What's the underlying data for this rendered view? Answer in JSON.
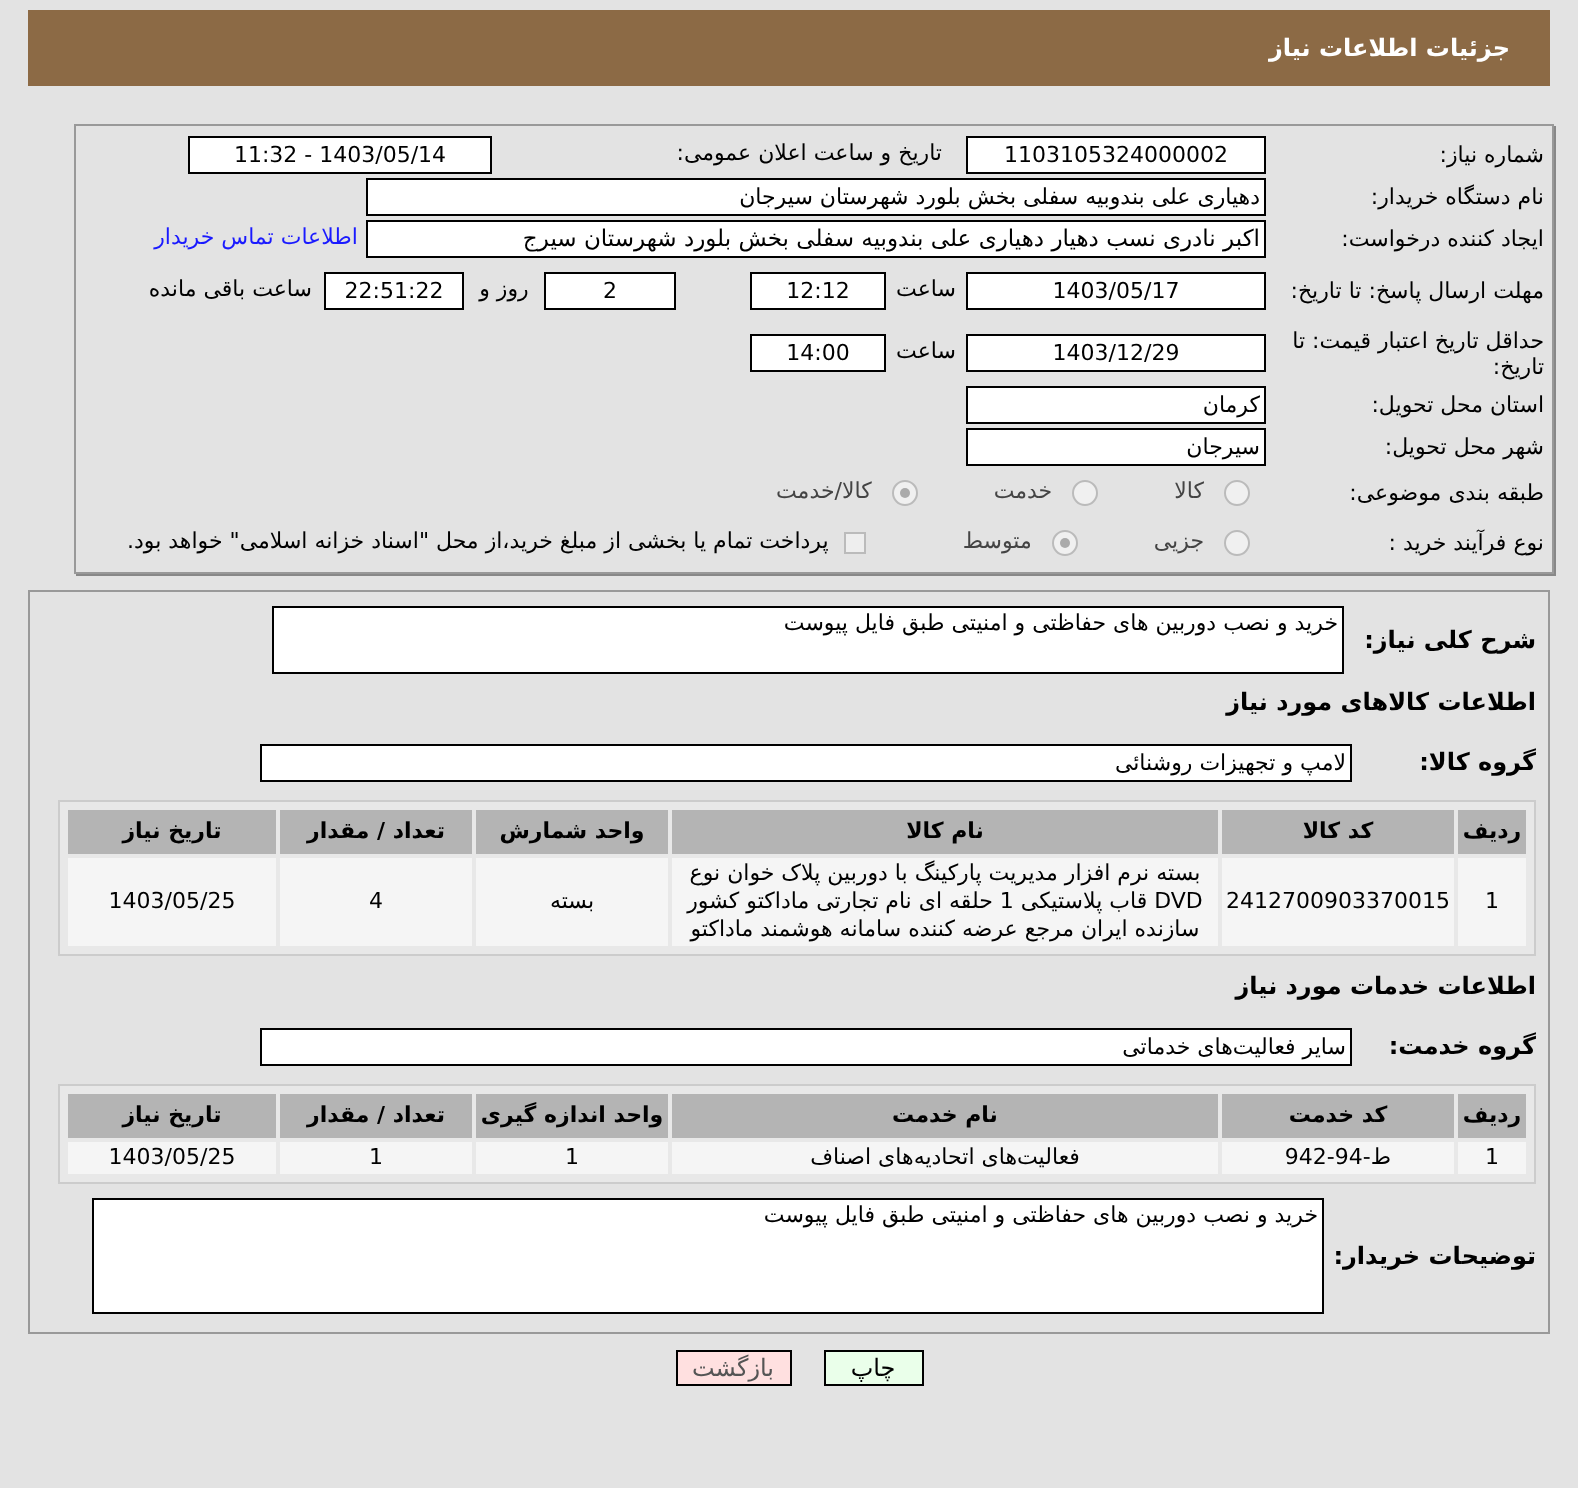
{
  "header": {
    "title": "جزئیات اطلاعات نیاز"
  },
  "need_number": {
    "label": "شماره نیاز:",
    "value": "1103105324000002"
  },
  "announce": {
    "label": "تاریخ و ساعت اعلان عمومی:",
    "value": "1403/05/14 - 11:32"
  },
  "buyer_org": {
    "label": "نام دستگاه خریدار:",
    "value": "دهیاری علی بندوبیه سفلی بخش بلورد شهرستان سیرجان"
  },
  "requester": {
    "label": "ایجاد کننده درخواست:",
    "value": "اکبر نادری نسب دهیار دهیاری علی بندوبیه سفلی بخش بلورد شهرستان سیرج",
    "link": "اطلاعات تماس خریدار"
  },
  "reply_deadline": {
    "label": "مهلت ارسال پاسخ: تا تاریخ:",
    "date": "1403/05/17",
    "time_label": "ساعت",
    "time": "12:12",
    "days": "2",
    "days_label": "روز و",
    "remaining": "22:51:22",
    "remaining_label": "ساعت باقی مانده"
  },
  "price_validity": {
    "label": "حداقل تاریخ اعتبار قیمت: تا تاریخ:",
    "date": "1403/12/29",
    "time_label": "ساعت",
    "time": "14:00"
  },
  "province": {
    "label": "استان محل تحویل:",
    "value": "کرمان"
  },
  "city": {
    "label": "شهر محل تحویل:",
    "value": "سیرجان"
  },
  "category": {
    "label": "طبقه بندی موضوعی:",
    "options": [
      {
        "label": "کالا",
        "selected": false
      },
      {
        "label": "خدمت",
        "selected": false
      },
      {
        "label": "کالا/خدمت",
        "selected": true
      }
    ]
  },
  "process": {
    "label": "نوع فرآیند خرید :",
    "options": [
      {
        "label": "جزیی",
        "selected": false
      },
      {
        "label": "متوسط",
        "selected": true
      }
    ],
    "checkbox": {
      "label": "پرداخت تمام یا بخشی از مبلغ خرید،از محل \"اسناد خزانه اسلامی\" خواهد بود.",
      "checked": false
    }
  },
  "description": {
    "label": "شرح کلی نیاز:",
    "value": "خرید و نصب دوربین های حفاظتی و امنیتی طبق فایل پیوست"
  },
  "goods": {
    "title": "اطلاعات کالاهای مورد نیاز",
    "group_label": "گروه کالا:",
    "group": "لامپ و تجهیزات روشنائی",
    "columns": [
      "ردیف",
      "کد کالا",
      "نام کالا",
      "واحد شمارش",
      "تعداد / مقدار",
      "تاریخ نیاز"
    ],
    "rows": [
      [
        "1",
        "2412700903370015",
        "بسته نرم افزار مدیریت پارکینگ با دوربین پلاک خوان نوع DVD قاب پلاستیکی 1 حلقه ای نام تجارتی ماداکتو کشور سازنده ایران مرجع عرضه کننده سامانه هوشمند ماداکتو",
        "بسته",
        "4",
        "1403/05/25"
      ]
    ]
  },
  "services": {
    "title": "اطلاعات خدمات مورد نیاز",
    "group_label": "گروه خدمت:",
    "group": "سایر فعالیت‌های خدماتی",
    "columns": [
      "ردیف",
      "کد خدمت",
      "نام خدمت",
      "واحد اندازه گیری",
      "تعداد / مقدار",
      "تاریخ نیاز"
    ],
    "rows": [
      [
        "1",
        "ط-94-942",
        "فعالیت‌های اتحادیه‌های اصناف",
        "1",
        "1",
        "1403/05/25"
      ]
    ]
  },
  "buyer_notes": {
    "label": "توضیحات خریدار:",
    "value": "خرید و نصب دوربین های حفاظتی و امنیتی طبق فایل پیوست"
  },
  "buttons": [
    {
      "kind": "print",
      "label": "چاپ"
    },
    {
      "kind": "back",
      "label": "بازگشت"
    }
  ]
}
